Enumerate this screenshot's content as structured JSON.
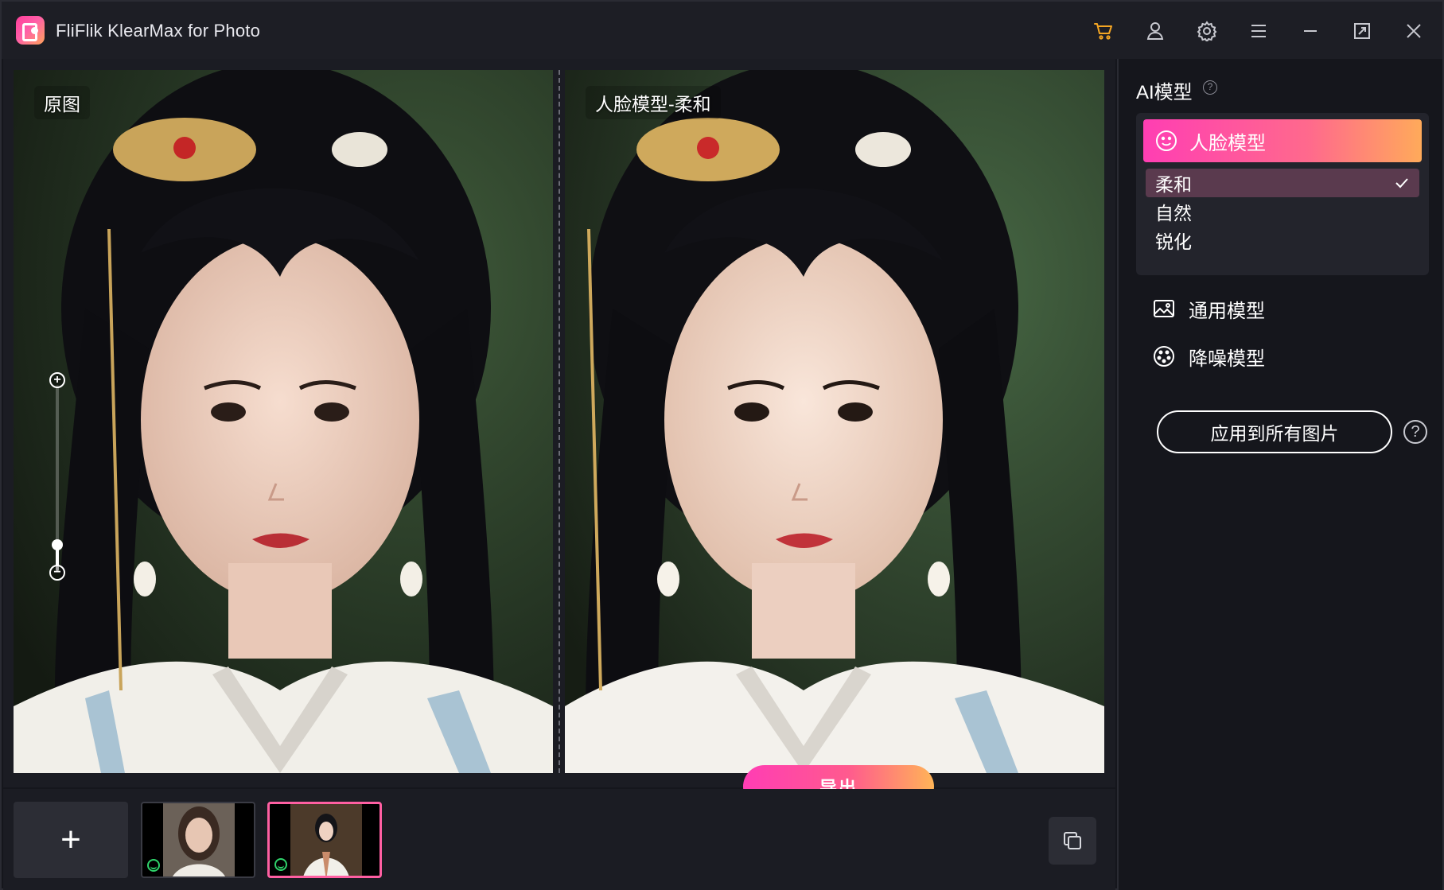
{
  "window": {
    "title": "FliFlik KlearMax for Photo",
    "icons": [
      "cart-icon",
      "user-icon",
      "settings-icon",
      "menu-icon",
      "minimize-icon",
      "maximize-icon",
      "close-icon"
    ],
    "accent": "#f5a623"
  },
  "preview": {
    "left_label": "原图",
    "right_label": "人脸模型-柔和",
    "export_label": "导出",
    "zoom_level": 0.14
  },
  "thumbnails": {
    "add_label": "+",
    "items": [
      {
        "status": "face-detected",
        "selected": false
      },
      {
        "status": "face-detected",
        "selected": true
      }
    ]
  },
  "sidebar": {
    "title": "AI模型",
    "active_model": "人脸模型",
    "sub_options": [
      "柔和",
      "自然",
      "锐化"
    ],
    "selected_sub_option": "柔和",
    "models": [
      "通用模型",
      "降噪模型"
    ],
    "apply_label": "应用到所有图片",
    "help_label": "?",
    "brand_gradient": [
      "#ff3eb3",
      "#ffaa5a"
    ]
  }
}
